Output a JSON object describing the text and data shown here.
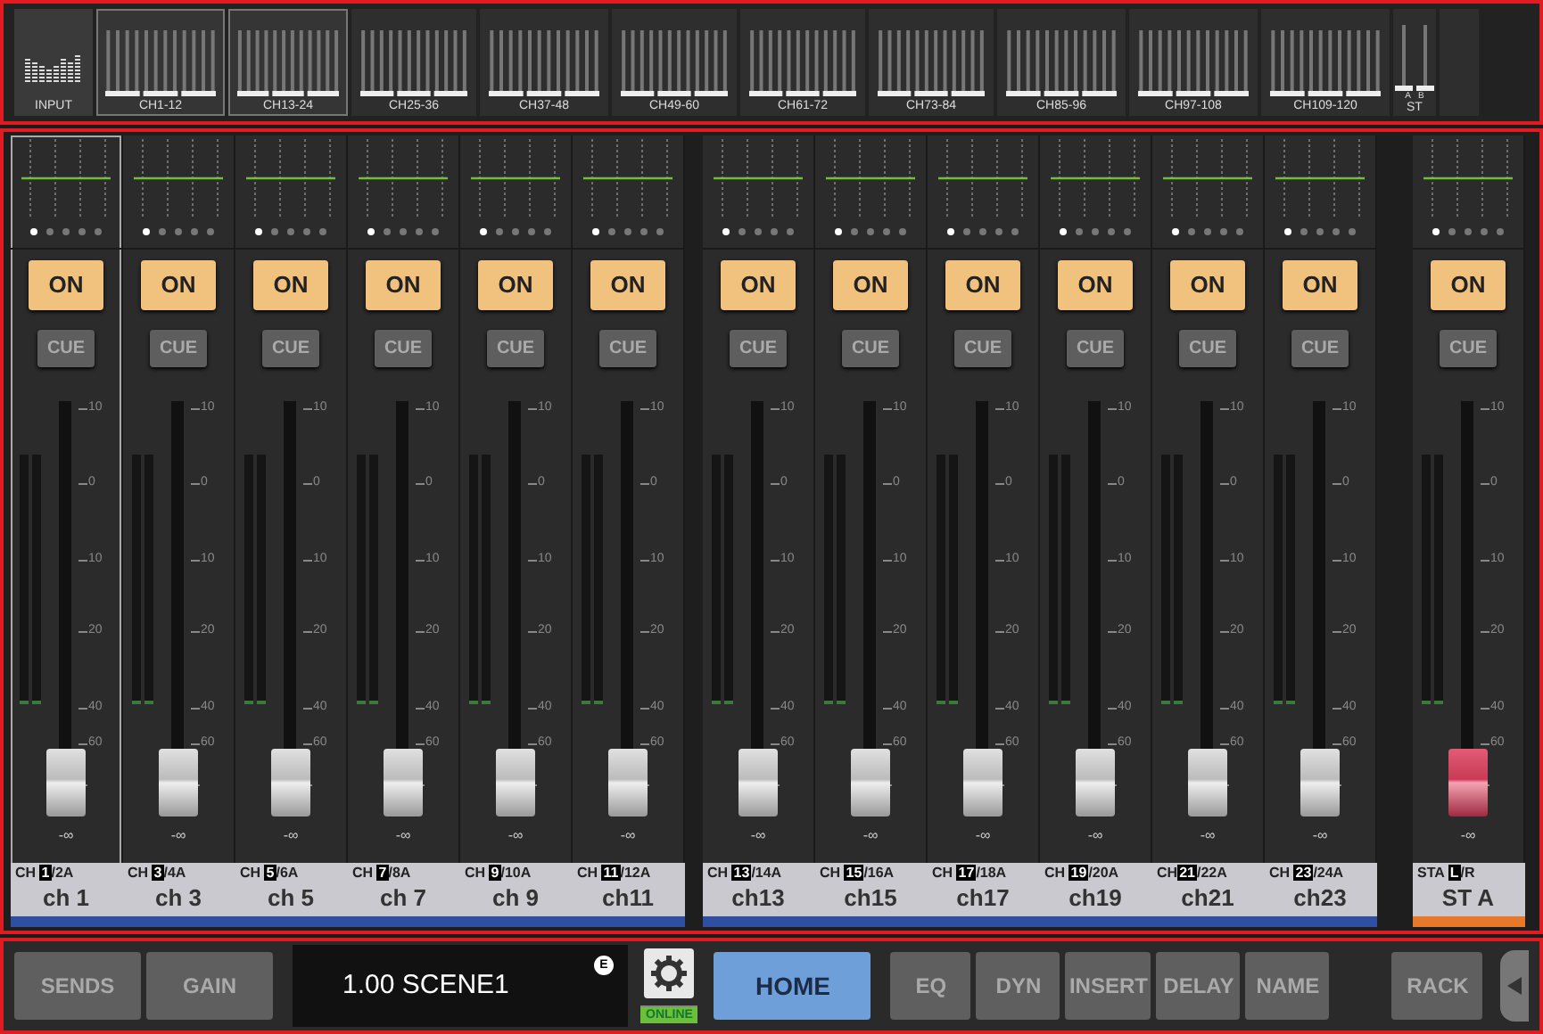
{
  "bank_bar": {
    "input_label": "INPUT",
    "banks": [
      {
        "label": "CH1-12",
        "kind": "mono",
        "selected": true
      },
      {
        "label": "CH13-24",
        "kind": "mono",
        "selected": true
      },
      {
        "label": "CH25-36",
        "kind": "mono",
        "selected": false
      },
      {
        "label": "CH37-48",
        "kind": "mono",
        "selected": false
      },
      {
        "label": "CH49-60",
        "kind": "mono",
        "selected": false
      },
      {
        "label": "CH61-72",
        "kind": "mono",
        "selected": false
      },
      {
        "label": "CH73-84",
        "kind": "mono",
        "selected": false
      },
      {
        "label": "CH85-96",
        "kind": "mono",
        "selected": false
      },
      {
        "label": "CH97-108",
        "kind": "mono",
        "selected": false
      },
      {
        "label": "CH109-120",
        "kind": "mono",
        "selected": false
      },
      {
        "label": "ST",
        "kind": "stereo",
        "selected": false,
        "sub_labels": [
          "A",
          "B"
        ]
      }
    ]
  },
  "strip_groups": [
    {
      "strips": [
        {
          "name": "ch 1",
          "port_prefix": "CH ",
          "port_number": "1",
          "port_suffix": "/2A",
          "color": "#2f4fa0",
          "kind": "mono",
          "selected": true,
          "on": "ON",
          "on_active": true,
          "cue": "CUE",
          "level": 0.07,
          "level_reading": "-∞",
          "scale": [
            "10",
            "0",
            "10",
            "20",
            "40",
            "60"
          ],
          "pages": [
            {
              "selected": true
            },
            {
              "selected": false
            },
            {
              "selected": false
            },
            {
              "selected": false
            },
            {
              "selected": false
            }
          ]
        },
        {
          "name": "ch 3",
          "port_prefix": "CH ",
          "port_number": "3",
          "port_suffix": "/4A",
          "color": "#2f4fa0",
          "kind": "mono",
          "selected": false,
          "on": "ON",
          "on_active": true,
          "cue": "CUE",
          "level": 0.07,
          "level_reading": "-∞",
          "scale": [
            "10",
            "0",
            "10",
            "20",
            "40",
            "60"
          ],
          "pages": [
            {
              "selected": true
            },
            {
              "selected": false
            },
            {
              "selected": false
            },
            {
              "selected": false
            },
            {
              "selected": false
            }
          ]
        },
        {
          "name": "ch 5",
          "port_prefix": "CH ",
          "port_number": "5",
          "port_suffix": "/6A",
          "color": "#2f4fa0",
          "kind": "mono",
          "selected": false,
          "on": "ON",
          "on_active": true,
          "cue": "CUE",
          "level": 0.07,
          "level_reading": "-∞",
          "scale": [
            "10",
            "0",
            "10",
            "20",
            "40",
            "60"
          ],
          "pages": [
            {
              "selected": true
            },
            {
              "selected": false
            },
            {
              "selected": false
            },
            {
              "selected": false
            },
            {
              "selected": false
            }
          ]
        },
        {
          "name": "ch 7",
          "port_prefix": "CH ",
          "port_number": "7",
          "port_suffix": "/8A",
          "color": "#2f4fa0",
          "kind": "mono",
          "selected": false,
          "on": "ON",
          "on_active": true,
          "cue": "CUE",
          "level": 0.07,
          "level_reading": "-∞",
          "scale": [
            "10",
            "0",
            "10",
            "20",
            "40",
            "60"
          ],
          "pages": [
            {
              "selected": true
            },
            {
              "selected": false
            },
            {
              "selected": false
            },
            {
              "selected": false
            },
            {
              "selected": false
            }
          ]
        },
        {
          "name": "ch 9",
          "port_prefix": "CH ",
          "port_number": "9",
          "port_suffix": "/10A",
          "color": "#2f4fa0",
          "kind": "mono",
          "selected": false,
          "on": "ON",
          "on_active": true,
          "cue": "CUE",
          "level": 0.07,
          "level_reading": "-∞",
          "scale": [
            "10",
            "0",
            "10",
            "20",
            "40",
            "60"
          ],
          "pages": [
            {
              "selected": true
            },
            {
              "selected": false
            },
            {
              "selected": false
            },
            {
              "selected": false
            },
            {
              "selected": false
            }
          ]
        },
        {
          "name": "ch11",
          "port_prefix": "CH ",
          "port_number": "11",
          "port_suffix": "/12A",
          "color": "#2f4fa0",
          "kind": "mono",
          "selected": false,
          "on": "ON",
          "on_active": true,
          "cue": "CUE",
          "level": 0.07,
          "level_reading": "-∞",
          "scale": [
            "10",
            "0",
            "10",
            "20",
            "40",
            "60"
          ],
          "pages": [
            {
              "selected": true
            },
            {
              "selected": false
            },
            {
              "selected": false
            },
            {
              "selected": false
            },
            {
              "selected": false
            }
          ]
        }
      ]
    },
    {
      "strips": [
        {
          "name": "ch13",
          "port_prefix": "CH ",
          "port_number": "13",
          "port_suffix": "/14A",
          "color": "#2f4fa0",
          "kind": "mono",
          "selected": false,
          "on": "ON",
          "on_active": true,
          "cue": "CUE",
          "level": 0.07,
          "level_reading": "-∞",
          "scale": [
            "10",
            "0",
            "10",
            "20",
            "40",
            "60"
          ],
          "pages": [
            {
              "selected": true
            },
            {
              "selected": false
            },
            {
              "selected": false
            },
            {
              "selected": false
            },
            {
              "selected": false
            }
          ]
        },
        {
          "name": "ch15",
          "port_prefix": "CH ",
          "port_number": "15",
          "port_suffix": "/16A",
          "color": "#2f4fa0",
          "kind": "mono",
          "selected": false,
          "on": "ON",
          "on_active": true,
          "cue": "CUE",
          "level": 0.07,
          "level_reading": "-∞",
          "scale": [
            "10",
            "0",
            "10",
            "20",
            "40",
            "60"
          ],
          "pages": [
            {
              "selected": true
            },
            {
              "selected": false
            },
            {
              "selected": false
            },
            {
              "selected": false
            },
            {
              "selected": false
            }
          ]
        },
        {
          "name": "ch17",
          "port_prefix": "CH ",
          "port_number": "17",
          "port_suffix": "/18A",
          "color": "#2f4fa0",
          "kind": "mono",
          "selected": false,
          "on": "ON",
          "on_active": true,
          "cue": "CUE",
          "level": 0.07,
          "level_reading": "-∞",
          "scale": [
            "10",
            "0",
            "10",
            "20",
            "40",
            "60"
          ],
          "pages": [
            {
              "selected": true
            },
            {
              "selected": false
            },
            {
              "selected": false
            },
            {
              "selected": false
            },
            {
              "selected": false
            }
          ]
        },
        {
          "name": "ch19",
          "port_prefix": "CH ",
          "port_number": "19",
          "port_suffix": "/20A",
          "color": "#2f4fa0",
          "kind": "mono",
          "selected": false,
          "on": "ON",
          "on_active": true,
          "cue": "CUE",
          "level": 0.07,
          "level_reading": "-∞",
          "scale": [
            "10",
            "0",
            "10",
            "20",
            "40",
            "60"
          ],
          "pages": [
            {
              "selected": true
            },
            {
              "selected": false
            },
            {
              "selected": false
            },
            {
              "selected": false
            },
            {
              "selected": false
            }
          ]
        },
        {
          "name": "ch21",
          "port_prefix": "CH",
          "port_number": "21",
          "port_suffix": "/22A",
          "color": "#2f4fa0",
          "kind": "mono",
          "selected": false,
          "on": "ON",
          "on_active": true,
          "cue": "CUE",
          "level": 0.07,
          "level_reading": "-∞",
          "scale": [
            "10",
            "0",
            "10",
            "20",
            "40",
            "60"
          ],
          "pages": [
            {
              "selected": true
            },
            {
              "selected": false
            },
            {
              "selected": false
            },
            {
              "selected": false
            },
            {
              "selected": false
            }
          ]
        },
        {
          "name": "ch23",
          "port_prefix": "CH ",
          "port_number": "23",
          "port_suffix": "/24A",
          "color": "#2f4fa0",
          "kind": "mono",
          "selected": false,
          "on": "ON",
          "on_active": true,
          "cue": "CUE",
          "level": 0.07,
          "level_reading": "-∞",
          "scale": [
            "10",
            "0",
            "10",
            "20",
            "40",
            "60"
          ],
          "pages": [
            {
              "selected": true
            },
            {
              "selected": false
            },
            {
              "selected": false
            },
            {
              "selected": false
            },
            {
              "selected": false
            }
          ]
        }
      ]
    },
    {
      "strips": [
        {
          "name": "ST A",
          "port_prefix": "STA ",
          "port_number": "L",
          "port_suffix": "/R",
          "color": "#e8782a",
          "kind": "stereo",
          "selected": false,
          "on": "ON",
          "on_active": true,
          "cue": "CUE",
          "level": 0.07,
          "level_reading": "-∞",
          "scale": [
            "10",
            "0",
            "10",
            "20",
            "40",
            "60"
          ],
          "pages": [
            {
              "selected": true
            },
            {
              "selected": false
            },
            {
              "selected": false
            },
            {
              "selected": false
            },
            {
              "selected": false
            }
          ]
        }
      ]
    }
  ],
  "toolbar": {
    "left_buttons": [
      {
        "label": "SENDS",
        "selected": false
      },
      {
        "label": "GAIN",
        "selected": false
      }
    ],
    "scene": {
      "title": "1.00 SCENE1",
      "badge": "E"
    },
    "status": "ONLINE",
    "home": {
      "label": "HOME",
      "selected": true
    },
    "right_buttons": [
      {
        "label": "EQ",
        "selected": false
      },
      {
        "label": "DYN",
        "selected": false
      },
      {
        "label": "INSERT",
        "selected": false
      },
      {
        "label": "DELAY",
        "selected": false
      },
      {
        "label": "NAME",
        "selected": false
      }
    ],
    "rack": {
      "label": "RACK",
      "selected": false
    }
  }
}
